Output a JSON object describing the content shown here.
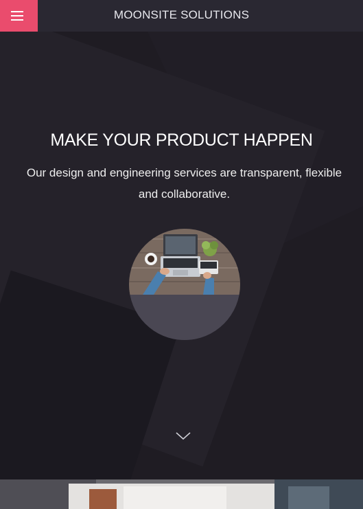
{
  "header": {
    "menu_icon": "hamburger-menu-icon",
    "site_title": "MOONSITE SOLUTIONS"
  },
  "hero": {
    "title": "MAKE YOUR PRODUCT HAPPEN",
    "subtitle": "Our design and engineering services are transparent, flexible and collaborative.",
    "image": "laptop-workspace-photo",
    "scroll_icon": "chevron-down-icon"
  },
  "colors": {
    "accent": "#ea4c6d",
    "header_bg": "#2a2832",
    "hero_bg": "#1f1c23"
  }
}
